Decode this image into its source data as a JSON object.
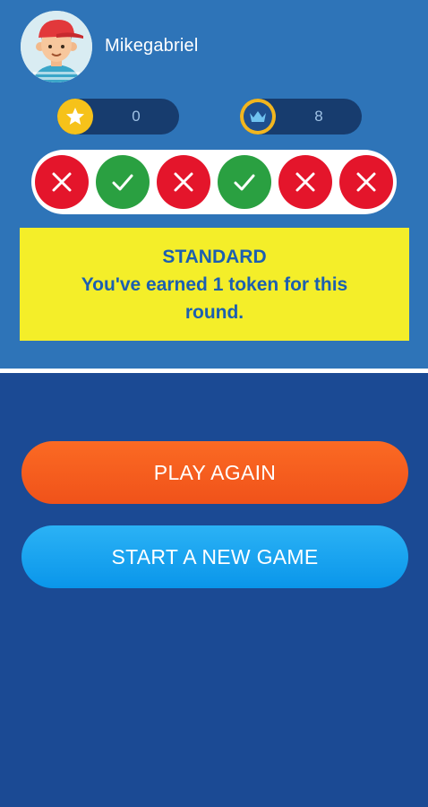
{
  "profile": {
    "username": "Mikegabriel"
  },
  "stats": {
    "stars": "0",
    "crowns": "8",
    "star_icon": "star-icon",
    "crown_icon": "crown-icon"
  },
  "results": [
    {
      "status": "wrong",
      "icon": "cross-icon"
    },
    {
      "status": "correct",
      "icon": "check-icon"
    },
    {
      "status": "wrong",
      "icon": "cross-icon"
    },
    {
      "status": "correct",
      "icon": "check-icon"
    },
    {
      "status": "wrong",
      "icon": "cross-icon"
    },
    {
      "status": "wrong",
      "icon": "cross-icon"
    }
  ],
  "banner": {
    "title": "STANDARD",
    "line1": "You've earned 1 token for this",
    "line2": "round."
  },
  "actions": {
    "play_again": "PLAY AGAIN",
    "new_game": "START A NEW GAME"
  },
  "colors": {
    "top_bg": "#2e74b8",
    "bottom_bg": "#1b4a94",
    "wrong": "#e4152b",
    "correct": "#2aa041",
    "banner_bg": "#f4ee29",
    "banner_text": "#1c5fb0",
    "play_button": "#f25a1d",
    "new_game_button": "#12a3ee"
  }
}
